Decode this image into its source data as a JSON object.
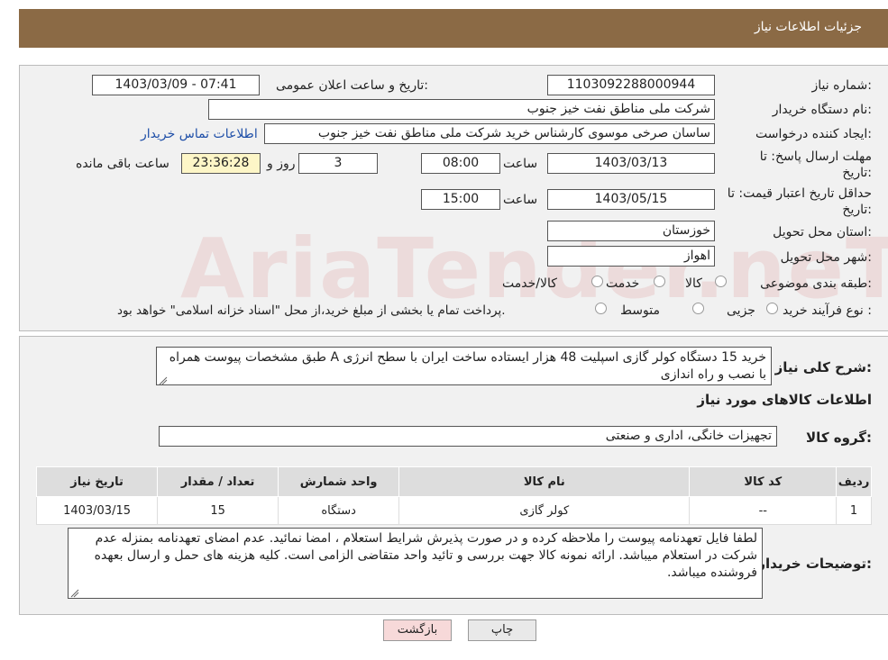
{
  "header": {
    "title": "جزئیات اطلاعات نیاز"
  },
  "form": {
    "need_number_label": "شماره نیاز:",
    "need_number": "1103092288000944",
    "announce_label": "تاریخ و ساعت اعلان عمومی:",
    "announce_value": "1403/03/09 - 07:41",
    "buyer_label": "نام دستگاه خریدار:",
    "buyer_value": "شرکت ملی مناطق نفت خیز جنوب",
    "creator_label": "ایجاد کننده درخواست:",
    "creator_value": "ساسان صرخی موسوی کارشناس خرید  شرکت ملی مناطق نفت خیز جنوب",
    "contact_link": "اطلاعات تماس خریدار",
    "deadline_label_1": "مهلت ارسال پاسخ: تا",
    "deadline_label_2": "تاریخ:",
    "deadline_date": "1403/03/13",
    "time_label": "ساعت",
    "deadline_time": "08:00",
    "days_value": "3",
    "days_label": "روز و",
    "remaining_time": "23:36:28",
    "remaining_label": "ساعت باقی مانده",
    "validity_label_1": "حداقل تاریخ اعتبار قیمت: تا",
    "validity_label_2": "تاریخ:",
    "validity_date": "1403/05/15",
    "validity_time": "15:00",
    "province_label": "استان محل تحویل:",
    "province_value": "خوزستان",
    "city_label": "شهر محل تحویل:",
    "city_value": "اهواز",
    "category_label": "طبقه بندی موضوعی:",
    "category_options": [
      "کالا",
      "خدمت",
      "کالا/خدمت"
    ],
    "process_label": "نوع فرآیند خرید :",
    "process_options": [
      "جزیی",
      "متوسط"
    ],
    "process_note": "پرداخت تمام یا بخشی از مبلغ خرید،از محل \"اسناد خزانه اسلامی\" خواهد بود."
  },
  "watermark": "AriaTender.neT",
  "description": {
    "label": "شرح کلی نیاز:",
    "text": "خرید 15 دستگاه کولر گازی اسپلیت 48 هزار ایستاده ساخت ایران با سطح انرژی A طبق مشخصات پیوست همراه با نصب و راه اندازی"
  },
  "goods": {
    "section_title": "اطلاعات کالاهای مورد نیاز",
    "group_label": "گروه کالا:",
    "group_value": "تجهیزات خانگی، اداری و صنعتی",
    "columns": [
      "ردیف",
      "کد کالا",
      "نام کالا",
      "واحد شمارش",
      "تعداد / مقدار",
      "تاریخ نیاز"
    ],
    "rows": [
      [
        "1",
        "--",
        "کولر گازی",
        "دستگاه",
        "15",
        "1403/03/15"
      ]
    ]
  },
  "notes": {
    "label": "توضیحات خریدار:",
    "text": "لطفا فایل تعهدنامه پیوست را ملاحظه کرده و در صورت پذیرش شرایط استعلام ، امضا نمائید. عدم امضای تعهدنامه بمنزله عدم شرکت در استعلام میباشد. ارائه نمونه کالا جهت بررسی و تائید واحد متقاضی الزامی است. کلیه هزینه های حمل و ارسال بعهده فروشنده میباشد."
  },
  "buttons": {
    "print": "چاپ",
    "back": "بازگشت"
  },
  "colors": {
    "header": "#8b6a45",
    "back_button": "#f7d9d9",
    "print_button": "#e9e9e9"
  }
}
